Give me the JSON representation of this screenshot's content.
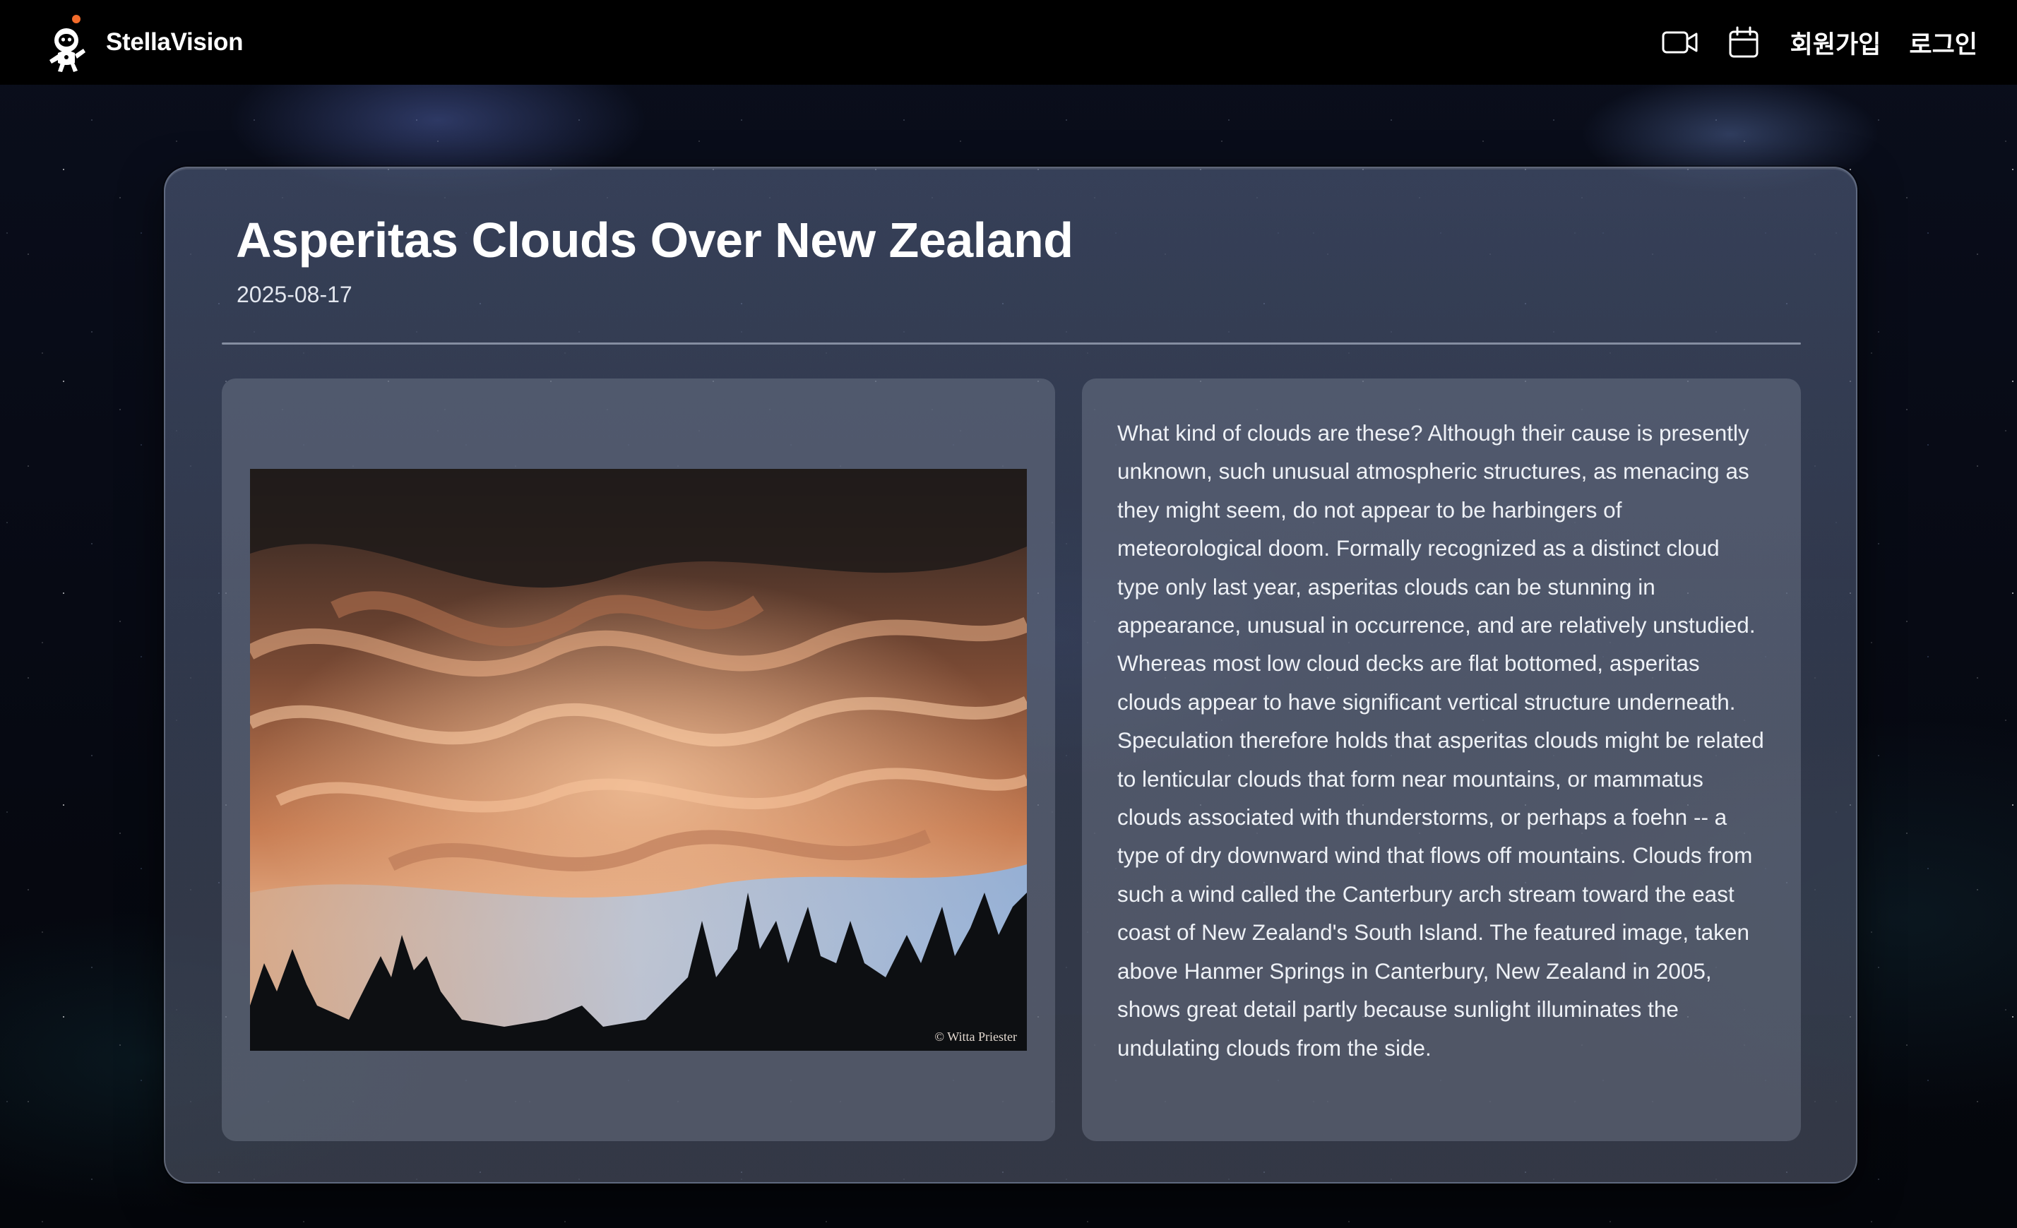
{
  "header": {
    "brand_name": "StellaVision",
    "nav": {
      "video_icon": "video-camera-icon",
      "calendar_icon": "calendar-icon",
      "signup_label": "회원가입",
      "login_label": "로그인"
    }
  },
  "apod": {
    "title": "Asperitas Clouds Over New Zealand",
    "date": "2025-08-17",
    "image_credit": "© Witta Priester",
    "explanation": "What kind of clouds are these? Although their cause is presently unknown, such unusual atmospheric structures, as menacing as they might seem, do not appear to be harbingers of meteorological doom. Formally recognized as a distinct cloud type only last year, asperitas clouds can be stunning in appearance, unusual in occurrence, and are relatively unstudied. Whereas most low cloud decks are flat bottomed, asperitas clouds appear to have significant vertical structure underneath. Speculation therefore holds that asperitas clouds might be related to lenticular clouds that form near mountains, or mammatus clouds associated with thunderstorms, or perhaps a foehn -- a type of dry downward wind that flows off mountains. Clouds from such a wind called the Canterbury arch stream toward the east coast of New Zealand's South Island. The featured image, taken above Hanmer Springs in Canterbury, New Zealand in 2005, shows great detail partly because sunlight illuminates the undulating clouds from the side."
  },
  "colors": {
    "topbar": "#000000",
    "logo_accent": "#f26b2b",
    "text_primary": "#ffffff"
  }
}
